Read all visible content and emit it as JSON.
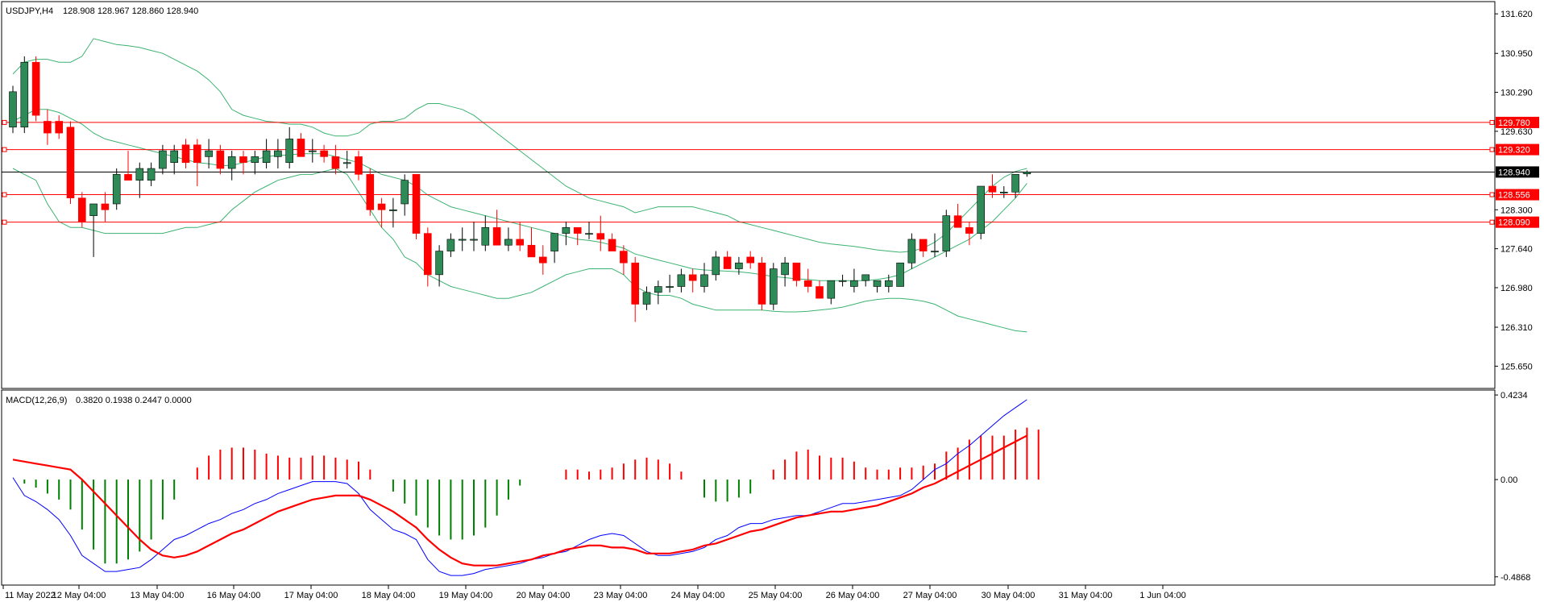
{
  "header": {
    "symbol_timeframe": "USDJPY,H4",
    "ohlc": "128.908 128.967 128.860 128.940"
  },
  "macd": {
    "label": "MACD(12,26,9)",
    "values": "0.3820 0.1938 0.2447 0.0000"
  },
  "colors": {
    "bull": "#2e8b57",
    "bear": "#ff0000",
    "bands": "#3cb371",
    "hline": "#ff0000",
    "macd_line": "#0000ff",
    "signal_line": "#ff0000"
  },
  "chart_data": [
    {
      "type": "candlestick",
      "title": "USDJPY,H4",
      "ylim": [
        125.3,
        131.8
      ],
      "y_ticks": [
        "131.620",
        "130.950",
        "130.290",
        "129.630",
        "128.300",
        "127.640",
        "126.980",
        "126.310",
        "125.650"
      ],
      "x_ticks": [
        "11 May 2022",
        "12 May 04:00",
        "13 May 04:00",
        "16 May 04:00",
        "17 May 04:00",
        "18 May 04:00",
        "19 May 04:00",
        "20 May 04:00",
        "23 May 04:00",
        "24 May 04:00",
        "25 May 04:00",
        "26 May 04:00",
        "27 May 04:00",
        "30 May 04:00",
        "31 May 04:00",
        "1 Jun 04:00"
      ],
      "price_levels": [
        "129.780",
        "129.320",
        "128.556",
        "128.090"
      ],
      "current_price": "128.940",
      "candles": [
        {
          "o": 129.7,
          "h": 130.4,
          "l": 129.6,
          "c": 130.3
        },
        {
          "o": 129.7,
          "h": 130.9,
          "l": 129.6,
          "c": 130.8
        },
        {
          "o": 130.8,
          "h": 130.9,
          "l": 129.8,
          "c": 129.9
        },
        {
          "o": 129.8,
          "h": 130.0,
          "l": 129.4,
          "c": 129.6
        },
        {
          "o": 129.8,
          "h": 129.9,
          "l": 129.5,
          "c": 129.6
        },
        {
          "o": 129.7,
          "h": 129.8,
          "l": 128.4,
          "c": 128.5
        },
        {
          "o": 128.5,
          "h": 128.6,
          "l": 128.0,
          "c": 128.1
        },
        {
          "o": 128.2,
          "h": 128.4,
          "l": 127.5,
          "c": 128.4
        },
        {
          "o": 128.4,
          "h": 128.6,
          "l": 128.1,
          "c": 128.3
        },
        {
          "o": 128.4,
          "h": 129.0,
          "l": 128.3,
          "c": 128.9
        },
        {
          "o": 128.9,
          "h": 129.3,
          "l": 128.8,
          "c": 128.8
        },
        {
          "o": 128.8,
          "h": 129.1,
          "l": 128.5,
          "c": 129.0
        },
        {
          "o": 128.8,
          "h": 129.1,
          "l": 128.7,
          "c": 129.0
        },
        {
          "o": 129.0,
          "h": 129.4,
          "l": 128.9,
          "c": 129.3
        },
        {
          "o": 129.1,
          "h": 129.4,
          "l": 128.9,
          "c": 129.3
        },
        {
          "o": 129.4,
          "h": 129.5,
          "l": 129.0,
          "c": 129.1
        },
        {
          "o": 129.4,
          "h": 129.5,
          "l": 128.7,
          "c": 129.1
        },
        {
          "o": 129.2,
          "h": 129.5,
          "l": 129.0,
          "c": 129.3
        },
        {
          "o": 129.3,
          "h": 129.4,
          "l": 128.9,
          "c": 129.0
        },
        {
          "o": 129.0,
          "h": 129.3,
          "l": 128.8,
          "c": 129.2
        },
        {
          "o": 129.2,
          "h": 129.3,
          "l": 128.9,
          "c": 129.1
        },
        {
          "o": 129.1,
          "h": 129.3,
          "l": 128.9,
          "c": 129.2
        },
        {
          "o": 129.1,
          "h": 129.5,
          "l": 129.0,
          "c": 129.3
        },
        {
          "o": 129.2,
          "h": 129.5,
          "l": 129.0,
          "c": 129.3
        },
        {
          "o": 129.1,
          "h": 129.7,
          "l": 129.0,
          "c": 129.5
        },
        {
          "o": 129.5,
          "h": 129.6,
          "l": 129.2,
          "c": 129.2
        },
        {
          "o": 129.3,
          "h": 129.5,
          "l": 129.1,
          "c": 129.3
        },
        {
          "o": 129.3,
          "h": 129.4,
          "l": 129.1,
          "c": 129.2
        },
        {
          "o": 129.2,
          "h": 129.4,
          "l": 128.9,
          "c": 129.0
        },
        {
          "o": 129.1,
          "h": 129.3,
          "l": 129.0,
          "c": 129.1
        },
        {
          "o": 129.2,
          "h": 129.3,
          "l": 128.8,
          "c": 128.9
        },
        {
          "o": 128.9,
          "h": 129.0,
          "l": 128.2,
          "c": 128.3
        },
        {
          "o": 128.4,
          "h": 128.5,
          "l": 128.0,
          "c": 128.3
        },
        {
          "o": 128.3,
          "h": 128.5,
          "l": 128.0,
          "c": 128.3
        },
        {
          "o": 128.4,
          "h": 128.9,
          "l": 128.2,
          "c": 128.8
        },
        {
          "o": 128.9,
          "h": 128.9,
          "l": 127.8,
          "c": 127.9
        },
        {
          "o": 127.9,
          "h": 128.0,
          "l": 127.0,
          "c": 127.2
        },
        {
          "o": 127.2,
          "h": 127.7,
          "l": 127.0,
          "c": 127.6
        },
        {
          "o": 127.6,
          "h": 127.9,
          "l": 127.5,
          "c": 127.8
        },
        {
          "o": 127.8,
          "h": 128.0,
          "l": 127.6,
          "c": 127.8
        },
        {
          "o": 127.8,
          "h": 128.1,
          "l": 127.6,
          "c": 127.8
        },
        {
          "o": 127.7,
          "h": 128.2,
          "l": 127.6,
          "c": 128.0
        },
        {
          "o": 128.0,
          "h": 128.3,
          "l": 127.7,
          "c": 127.7
        },
        {
          "o": 127.7,
          "h": 128.0,
          "l": 127.6,
          "c": 127.8
        },
        {
          "o": 127.8,
          "h": 128.1,
          "l": 127.6,
          "c": 127.7
        },
        {
          "o": 127.7,
          "h": 128.0,
          "l": 127.5,
          "c": 127.5
        },
        {
          "o": 127.5,
          "h": 127.7,
          "l": 127.2,
          "c": 127.4
        },
        {
          "o": 127.6,
          "h": 127.9,
          "l": 127.4,
          "c": 127.9
        },
        {
          "o": 127.9,
          "h": 128.1,
          "l": 127.7,
          "c": 128.0
        },
        {
          "o": 128.0,
          "h": 128.0,
          "l": 127.7,
          "c": 127.9
        },
        {
          "o": 127.9,
          "h": 128.1,
          "l": 127.8,
          "c": 127.9
        },
        {
          "o": 127.9,
          "h": 128.2,
          "l": 127.6,
          "c": 127.8
        },
        {
          "o": 127.8,
          "h": 127.9,
          "l": 127.6,
          "c": 127.6
        },
        {
          "o": 127.6,
          "h": 127.7,
          "l": 127.2,
          "c": 127.4
        },
        {
          "o": 127.4,
          "h": 127.5,
          "l": 126.4,
          "c": 126.7
        },
        {
          "o": 126.7,
          "h": 127.0,
          "l": 126.6,
          "c": 126.9
        },
        {
          "o": 126.9,
          "h": 127.1,
          "l": 126.7,
          "c": 127.0
        },
        {
          "o": 127.0,
          "h": 127.2,
          "l": 126.9,
          "c": 127.0
        },
        {
          "o": 127.0,
          "h": 127.3,
          "l": 126.9,
          "c": 127.2
        },
        {
          "o": 127.2,
          "h": 127.3,
          "l": 126.9,
          "c": 127.1
        },
        {
          "o": 127.0,
          "h": 127.4,
          "l": 126.9,
          "c": 127.2
        },
        {
          "o": 127.2,
          "h": 127.6,
          "l": 127.1,
          "c": 127.5
        },
        {
          "o": 127.5,
          "h": 127.6,
          "l": 127.3,
          "c": 127.3
        },
        {
          "o": 127.3,
          "h": 127.5,
          "l": 127.2,
          "c": 127.4
        },
        {
          "o": 127.5,
          "h": 127.6,
          "l": 127.3,
          "c": 127.4
        },
        {
          "o": 127.4,
          "h": 127.5,
          "l": 126.6,
          "c": 126.7
        },
        {
          "o": 126.7,
          "h": 127.4,
          "l": 126.6,
          "c": 127.3
        },
        {
          "o": 127.2,
          "h": 127.5,
          "l": 127.0,
          "c": 127.4
        },
        {
          "o": 127.4,
          "h": 127.4,
          "l": 127.0,
          "c": 127.1
        },
        {
          "o": 127.1,
          "h": 127.3,
          "l": 126.9,
          "c": 127.0
        },
        {
          "o": 127.0,
          "h": 127.1,
          "l": 126.8,
          "c": 126.8
        },
        {
          "o": 126.8,
          "h": 127.1,
          "l": 126.7,
          "c": 127.1
        },
        {
          "o": 127.1,
          "h": 127.2,
          "l": 127.0,
          "c": 127.1
        },
        {
          "o": 127.0,
          "h": 127.3,
          "l": 126.9,
          "c": 127.1
        },
        {
          "o": 127.1,
          "h": 127.2,
          "l": 127.0,
          "c": 127.2
        },
        {
          "o": 127.0,
          "h": 127.1,
          "l": 126.9,
          "c": 127.1
        },
        {
          "o": 127.0,
          "h": 127.2,
          "l": 126.9,
          "c": 127.1
        },
        {
          "o": 127.0,
          "h": 127.4,
          "l": 127.0,
          "c": 127.4
        },
        {
          "o": 127.4,
          "h": 127.9,
          "l": 127.3,
          "c": 127.8
        },
        {
          "o": 127.8,
          "h": 127.8,
          "l": 127.5,
          "c": 127.6
        },
        {
          "o": 127.6,
          "h": 127.9,
          "l": 127.5,
          "c": 127.6
        },
        {
          "o": 127.6,
          "h": 128.3,
          "l": 127.5,
          "c": 128.2
        },
        {
          "o": 128.2,
          "h": 128.4,
          "l": 128.0,
          "c": 128.0
        },
        {
          "o": 128.0,
          "h": 128.1,
          "l": 127.7,
          "c": 127.9
        },
        {
          "o": 127.9,
          "h": 128.7,
          "l": 127.8,
          "c": 128.7
        },
        {
          "o": 128.7,
          "h": 128.9,
          "l": 128.5,
          "c": 128.6
        },
        {
          "o": 128.6,
          "h": 128.7,
          "l": 128.5,
          "c": 128.6
        },
        {
          "o": 128.6,
          "h": 128.9,
          "l": 128.5,
          "c": 128.9
        },
        {
          "o": 128.908,
          "h": 128.967,
          "l": 128.86,
          "c": 128.94
        }
      ],
      "bb_upper": [
        130.6,
        130.8,
        130.85,
        130.85,
        130.8,
        130.8,
        130.9,
        131.2,
        131.15,
        131.1,
        131.08,
        131.05,
        131.0,
        130.95,
        130.85,
        130.75,
        130.65,
        130.5,
        130.3,
        130.0,
        129.9,
        129.85,
        129.8,
        129.78,
        129.75,
        129.75,
        129.7,
        129.6,
        129.55,
        129.55,
        129.6,
        129.75,
        129.8,
        129.8,
        129.85,
        130.0,
        130.1,
        130.1,
        130.05,
        130.0,
        129.9,
        129.75,
        129.6,
        129.45,
        129.3,
        129.15,
        129.0,
        128.85,
        128.7,
        128.6,
        128.5,
        128.45,
        128.4,
        128.35,
        128.25,
        128.3,
        128.35,
        128.35,
        128.35,
        128.35,
        128.3,
        128.25,
        128.2,
        128.1,
        128.05,
        128.0,
        127.95,
        127.9,
        127.85,
        127.8,
        127.75,
        127.72,
        127.7,
        127.68,
        127.65,
        127.62,
        127.6,
        127.58,
        127.6,
        127.65,
        127.75,
        127.9,
        128.1,
        128.3,
        128.5,
        128.7,
        128.85,
        128.95,
        129.0
      ],
      "bb_middle": [
        129.8,
        129.9,
        130.0,
        130.0,
        129.95,
        129.85,
        129.75,
        129.6,
        129.5,
        129.45,
        129.4,
        129.35,
        129.3,
        129.25,
        129.2,
        129.15,
        129.1,
        129.08,
        129.05,
        129.05,
        129.1,
        129.15,
        129.2,
        129.22,
        129.23,
        129.25,
        129.25,
        129.25,
        129.2,
        129.15,
        129.1,
        129.0,
        128.9,
        128.85,
        128.8,
        128.7,
        128.55,
        128.45,
        128.35,
        128.3,
        128.25,
        128.2,
        128.15,
        128.1,
        128.05,
        128.0,
        127.95,
        127.9,
        127.85,
        127.8,
        127.78,
        127.75,
        127.7,
        127.65,
        127.55,
        127.5,
        127.45,
        127.4,
        127.35,
        127.3,
        127.28,
        127.27,
        127.26,
        127.25,
        127.23,
        127.2,
        127.17,
        127.15,
        127.13,
        127.12,
        127.1,
        127.1,
        127.1,
        127.1,
        127.1,
        127.12,
        127.15,
        127.2,
        127.3,
        127.4,
        127.5,
        127.6,
        127.7,
        127.8,
        127.95,
        128.1,
        128.3,
        128.5,
        128.75
      ],
      "bb_lower": [
        129.0,
        128.9,
        128.8,
        128.4,
        128.1,
        128.0,
        128.0,
        127.95,
        127.9,
        127.9,
        127.9,
        127.9,
        127.9,
        127.9,
        127.95,
        128.0,
        128.0,
        128.05,
        128.1,
        128.3,
        128.45,
        128.6,
        128.7,
        128.8,
        128.85,
        128.9,
        128.9,
        128.95,
        129.0,
        128.9,
        128.6,
        128.3,
        128.0,
        127.8,
        127.5,
        127.4,
        127.2,
        127.1,
        127.0,
        126.95,
        126.9,
        126.85,
        126.8,
        126.8,
        126.85,
        126.9,
        127.0,
        127.1,
        127.2,
        127.25,
        127.3,
        127.3,
        127.3,
        127.2,
        127.0,
        126.9,
        126.85,
        126.85,
        126.8,
        126.7,
        126.65,
        126.6,
        126.6,
        126.6,
        126.6,
        126.6,
        126.58,
        126.57,
        126.57,
        126.58,
        126.6,
        126.62,
        126.65,
        126.7,
        126.75,
        126.78,
        126.8,
        126.8,
        126.78,
        126.75,
        126.7,
        126.6,
        126.5,
        126.45,
        126.4,
        126.35,
        126.3,
        126.25,
        126.23
      ]
    },
    {
      "type": "macd",
      "title": "MACD(12,26,9)",
      "ylim": [
        -0.52,
        0.44
      ],
      "y_ticks": [
        "0.4234",
        "0.00",
        "-0.4868"
      ],
      "histogram": [
        0.0,
        -0.02,
        -0.04,
        -0.07,
        -0.1,
        -0.15,
        -0.25,
        -0.35,
        -0.42,
        -0.42,
        -0.4,
        -0.36,
        -0.3,
        -0.2,
        -0.1,
        0.0,
        0.06,
        0.12,
        0.15,
        0.16,
        0.16,
        0.15,
        0.13,
        0.12,
        0.11,
        0.11,
        0.12,
        0.12,
        0.11,
        0.1,
        0.09,
        0.05,
        0.0,
        -0.06,
        -0.12,
        -0.18,
        -0.24,
        -0.28,
        -0.3,
        -0.3,
        -0.28,
        -0.24,
        -0.18,
        -0.1,
        -0.03,
        0.0,
        0.0,
        0.0,
        0.05,
        0.05,
        0.04,
        0.05,
        0.06,
        0.08,
        0.1,
        0.11,
        0.1,
        0.08,
        0.04,
        0.0,
        -0.09,
        -0.11,
        -0.11,
        -0.09,
        -0.07,
        0.0,
        0.05,
        0.1,
        0.14,
        0.15,
        0.12,
        0.11,
        0.11,
        0.09,
        0.06,
        0.05,
        0.05,
        0.06,
        0.06,
        0.07,
        0.08,
        0.14,
        0.16,
        0.2,
        0.22,
        0.22,
        0.22,
        0.25,
        0.26,
        0.25
      ],
      "macd_line": [
        0.01,
        -0.08,
        -0.11,
        -0.15,
        -0.2,
        -0.28,
        -0.38,
        -0.42,
        -0.46,
        -0.46,
        -0.45,
        -0.44,
        -0.4,
        -0.35,
        -0.3,
        -0.28,
        -0.25,
        -0.22,
        -0.2,
        -0.17,
        -0.15,
        -0.12,
        -0.1,
        -0.07,
        -0.05,
        -0.03,
        -0.01,
        -0.01,
        -0.01,
        -0.02,
        -0.07,
        -0.15,
        -0.2,
        -0.25,
        -0.27,
        -0.3,
        -0.4,
        -0.46,
        -0.48,
        -0.48,
        -0.47,
        -0.45,
        -0.44,
        -0.43,
        -0.42,
        -0.4,
        -0.39,
        -0.37,
        -0.36,
        -0.33,
        -0.3,
        -0.28,
        -0.27,
        -0.28,
        -0.32,
        -0.36,
        -0.38,
        -0.38,
        -0.37,
        -0.36,
        -0.34,
        -0.3,
        -0.28,
        -0.24,
        -0.22,
        -0.22,
        -0.2,
        -0.19,
        -0.18,
        -0.18,
        -0.16,
        -0.14,
        -0.12,
        -0.12,
        -0.11,
        -0.1,
        -0.09,
        -0.08,
        -0.05,
        0.0,
        0.05,
        0.08,
        0.13,
        0.17,
        0.22,
        0.27,
        0.32,
        0.36,
        0.4
      ],
      "signal_line": [
        0.1,
        0.09,
        0.08,
        0.07,
        0.06,
        0.05,
        0.0,
        -0.06,
        -0.12,
        -0.18,
        -0.24,
        -0.3,
        -0.35,
        -0.38,
        -0.39,
        -0.38,
        -0.36,
        -0.33,
        -0.3,
        -0.27,
        -0.25,
        -0.22,
        -0.19,
        -0.16,
        -0.14,
        -0.12,
        -0.1,
        -0.09,
        -0.08,
        -0.08,
        -0.08,
        -0.1,
        -0.13,
        -0.16,
        -0.2,
        -0.24,
        -0.3,
        -0.35,
        -0.39,
        -0.42,
        -0.43,
        -0.43,
        -0.43,
        -0.42,
        -0.41,
        -0.4,
        -0.38,
        -0.37,
        -0.35,
        -0.34,
        -0.33,
        -0.33,
        -0.34,
        -0.34,
        -0.35,
        -0.37,
        -0.37,
        -0.37,
        -0.36,
        -0.35,
        -0.33,
        -0.32,
        -0.3,
        -0.28,
        -0.26,
        -0.25,
        -0.23,
        -0.21,
        -0.19,
        -0.18,
        -0.17,
        -0.16,
        -0.16,
        -0.15,
        -0.14,
        -0.13,
        -0.11,
        -0.09,
        -0.07,
        -0.04,
        -0.02,
        0.01,
        0.04,
        0.07,
        0.1,
        0.13,
        0.16,
        0.19,
        0.22
      ]
    }
  ]
}
